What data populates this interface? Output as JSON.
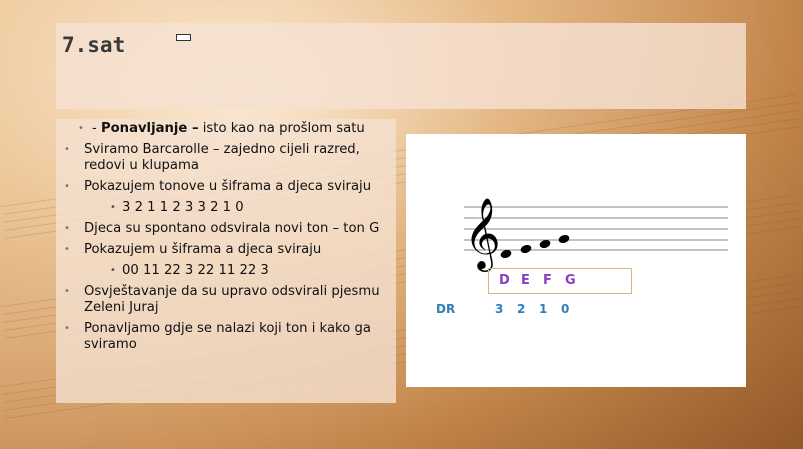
{
  "slide": {
    "title": "7.sat",
    "bullets": [
      {
        "lead": "- ",
        "bold": "Ponavljanje –",
        "rest": " isto kao na prošlom satu"
      },
      {
        "text": "Sviramo Barcarolle – zajedno cijeli razred, redovi u klupama"
      },
      {
        "text": "Pokazujem tonove u šiframa a djeca sviraju"
      },
      {
        "text": "3 2 1 1 2 3 3 2 1 0",
        "sub": true
      },
      {
        "text": "Djeca su spontano odsvirala novi ton – ton G"
      },
      {
        "text": "Pokazujem u šiframa a djeca sviraju"
      },
      {
        "text": "00 11 22 3  22 11 22 3",
        "sub": true
      },
      {
        "text": "Osvještavanje da su upravo odsvirali pjesmu Zeleni Juraj"
      },
      {
        "text": "Ponavljamo gdje se nalazi koji ton i kako ga sviramo"
      }
    ]
  },
  "music_image": {
    "note_names": [
      "D",
      "E",
      "F",
      "G"
    ],
    "dr_label": "DR",
    "dr_numbers": [
      "3",
      "2",
      "1",
      "0"
    ],
    "note_name_color": "#8a3fc0",
    "dr_color": "#2e7fb8"
  }
}
